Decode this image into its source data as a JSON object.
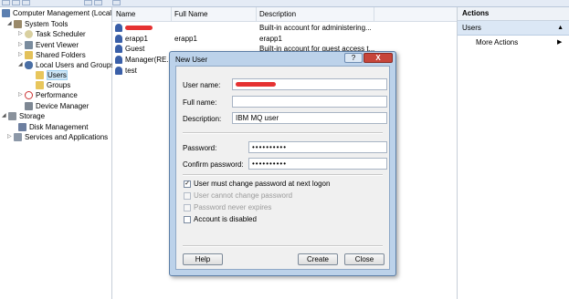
{
  "tree": {
    "items": [
      {
        "label": "Computer Management (Local",
        "icon": "computer-icon"
      },
      {
        "label": "System Tools",
        "icon": "tools-icon"
      },
      {
        "label": "Task Scheduler",
        "icon": "clock-icon"
      },
      {
        "label": "Event Viewer",
        "icon": "event-viewer-icon"
      },
      {
        "label": "Shared Folders",
        "icon": "shared-folder-icon"
      },
      {
        "label": "Local Users and Groups",
        "icon": "users-groups-icon"
      },
      {
        "label": "Users",
        "icon": "folder-icon"
      },
      {
        "label": "Groups",
        "icon": "folder-icon"
      },
      {
        "label": "Performance",
        "icon": "performance-icon"
      },
      {
        "label": "Device Manager",
        "icon": "device-manager-icon"
      },
      {
        "label": "Storage",
        "icon": "storage-icon"
      },
      {
        "label": "Disk Management",
        "icon": "disk-icon"
      },
      {
        "label": "Services and Applications",
        "icon": "services-icon"
      }
    ]
  },
  "list": {
    "columns": [
      "Name",
      "Full Name",
      "Description"
    ],
    "rows": [
      {
        "name": "",
        "full_name": "",
        "description": "Built-in account for administering..."
      },
      {
        "name": "erapp1",
        "full_name": "erapp1",
        "description": "erapp1"
      },
      {
        "name": "Guest",
        "full_name": "",
        "description": "Built-in account for guest access t..."
      },
      {
        "name": "Manager(RE...",
        "full_name": "",
        "description": ""
      },
      {
        "name": "test",
        "full_name": "",
        "description": ""
      }
    ]
  },
  "actions": {
    "header": "Actions",
    "section": "Users",
    "items": [
      "More Actions"
    ]
  },
  "dialog": {
    "title": "New User",
    "help_glyph": "?",
    "close_glyph": "X",
    "labels": {
      "user_name": "User name:",
      "full_name": "Full name:",
      "description": "Description:",
      "password": "Password:",
      "confirm_password": "Confirm password:"
    },
    "values": {
      "user_name": "",
      "full_name": "",
      "description": "IBM MQ user",
      "password": "••••••••••",
      "confirm_password": "••••••••••"
    },
    "checkboxes": [
      {
        "label": "User must change password at next logon",
        "checked": true,
        "enabled": true
      },
      {
        "label": "User cannot change password",
        "checked": false,
        "enabled": false
      },
      {
        "label": "Password never expires",
        "checked": false,
        "enabled": false
      },
      {
        "label": "Account is disabled",
        "checked": false,
        "enabled": true
      }
    ],
    "buttons": {
      "help": "Help",
      "create": "Create",
      "close": "Close"
    }
  },
  "colors": {
    "redaction": "#e53232",
    "dialog_frame": "#bcd2ea",
    "close_button": "#c7453a"
  }
}
